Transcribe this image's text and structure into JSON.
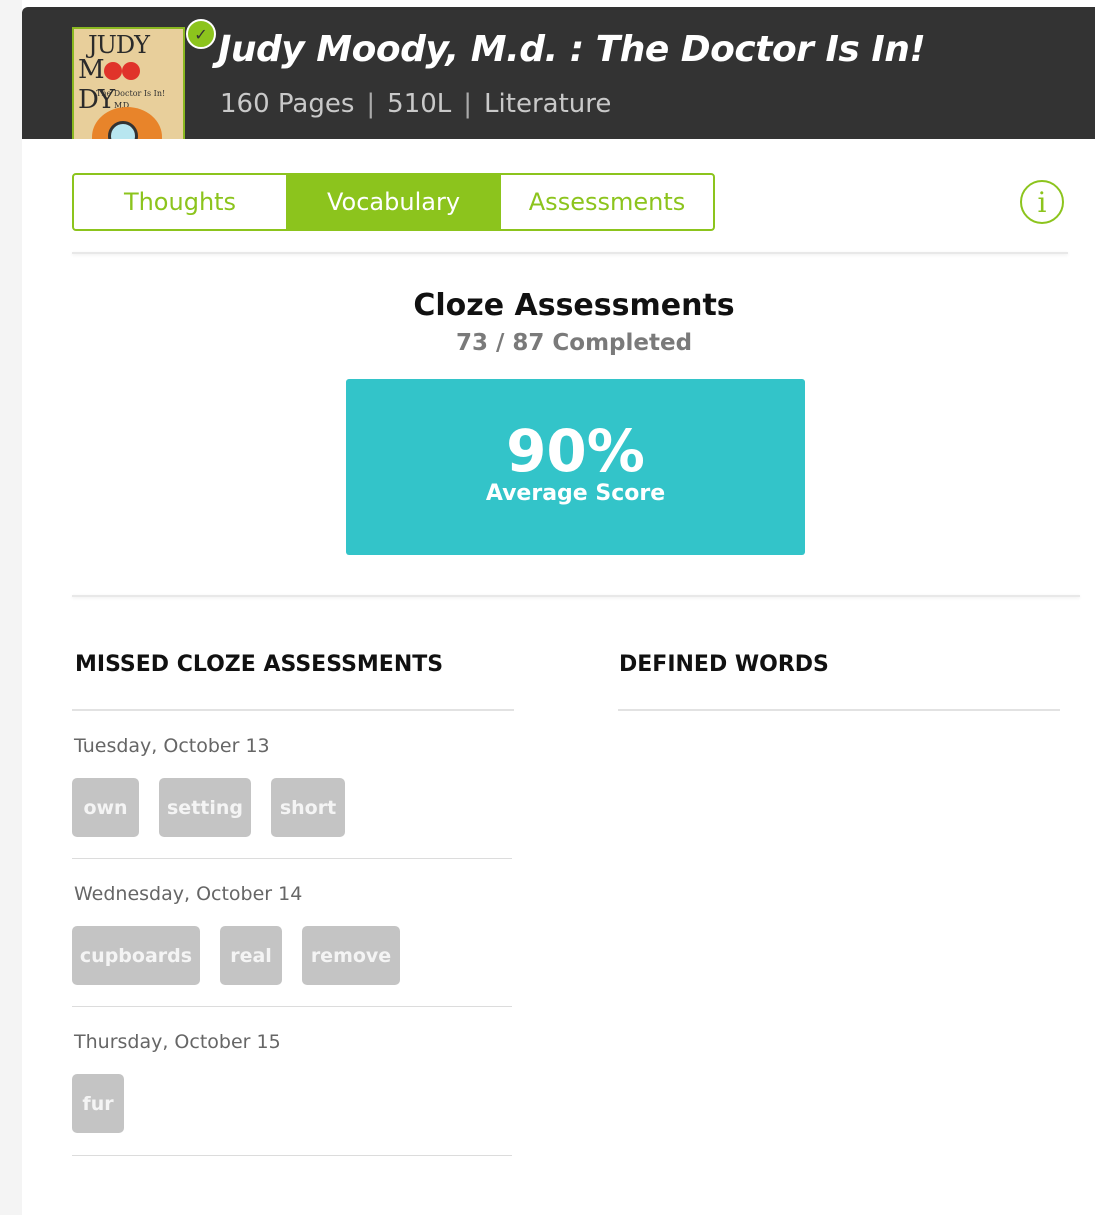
{
  "book": {
    "title": "Judy Moody, M.d. : The Doctor Is In!",
    "pages": "160 Pages",
    "lexile": "510L",
    "genre": "Literature",
    "separator": "|",
    "cover": {
      "line1": "JUDY",
      "line2_a": "M",
      "line2_b": "DY",
      "md": "M.D",
      "subtitle": "The Doctor Is In!"
    },
    "completed_check": "✓"
  },
  "tabs": [
    {
      "label": "Thoughts",
      "active": false
    },
    {
      "label": "Vocabulary",
      "active": true
    },
    {
      "label": "Assessments",
      "active": false
    }
  ],
  "info_icon": "i",
  "summary": {
    "title": "Cloze Assessments",
    "completed": "73 / 87 Completed",
    "score_value": "90%",
    "score_label": "Average Score"
  },
  "missed": {
    "heading": "MISSED CLOZE ASSESSMENTS",
    "days": [
      {
        "date": "Tuesday, October 13",
        "words": [
          "own",
          "setting",
          "short"
        ]
      },
      {
        "date": "Wednesday, October 14",
        "words": [
          "cupboards",
          "real",
          "remove"
        ]
      },
      {
        "date": "Thursday, October 15",
        "words": [
          "fur"
        ]
      }
    ]
  },
  "defined": {
    "heading": "DEFINED WORDS"
  },
  "colors": {
    "accent": "#8cc41d",
    "score": "#33c4c9",
    "header": "#333333",
    "chip": "#c4c4c4"
  }
}
